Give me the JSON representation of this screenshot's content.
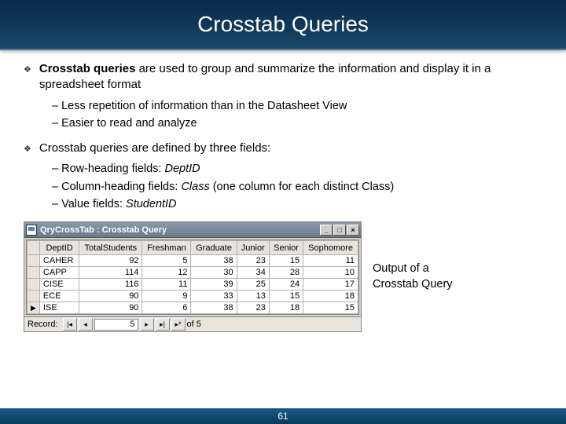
{
  "slide": {
    "title": "Crosstab Queries",
    "page_number": "61"
  },
  "bullets": {
    "b1_bold": "Crosstab queries",
    "b1_rest": " are used to group and summarize the information and display it in a spreadsheet format",
    "b1_sub1": "– Less repetition of information than in the Datasheet View",
    "b1_sub2": "– Easier to read and analyze",
    "b2": "Crosstab queries are defined by three fields:",
    "b2_sub1_a": "– Row-heading fields: ",
    "b2_sub1_b": "DeptID",
    "b2_sub2_a": "– Column-heading fields: ",
    "b2_sub2_b": "Class",
    "b2_sub2_c": " (one column for each distinct Class)",
    "b2_sub3_a": "– Value fields: ",
    "b2_sub3_b": "StudentID"
  },
  "caption": "Output of a Crosstab Query",
  "window": {
    "title": "QryCrossTab : Crosstab Query",
    "columns": [
      "DeptID",
      "TotalStudents",
      "Freshman",
      "Graduate",
      "Junior",
      "Senior",
      "Sophomore"
    ],
    "rows": [
      {
        "dept": "CAHER",
        "v": [
          "92",
          "5",
          "38",
          "23",
          "15",
          "11"
        ]
      },
      {
        "dept": "CAPP",
        "v": [
          "114",
          "12",
          "30",
          "34",
          "28",
          "10"
        ]
      },
      {
        "dept": "CISE",
        "v": [
          "116",
          "11",
          "39",
          "25",
          "24",
          "17"
        ]
      },
      {
        "dept": "ECE",
        "v": [
          "90",
          "9",
          "33",
          "13",
          "15",
          "18"
        ]
      },
      {
        "dept": "ISE",
        "v": [
          "90",
          "6",
          "38",
          "23",
          "18",
          "15"
        ]
      }
    ],
    "record": {
      "label": "Record:",
      "current": "5",
      "of": "of 5"
    }
  }
}
